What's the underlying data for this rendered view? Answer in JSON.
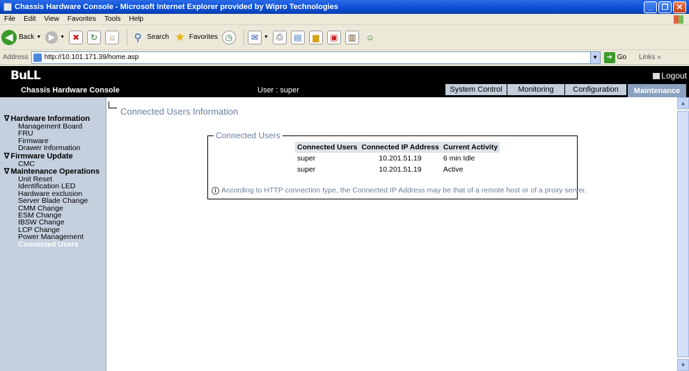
{
  "window": {
    "title": "Chassis Hardware Console - Microsoft Internet Explorer provided by Wipro Technologies"
  },
  "menu": [
    "File",
    "Edit",
    "View",
    "Favorites",
    "Tools",
    "Help"
  ],
  "toolbar": {
    "back": "Back",
    "search": "Search",
    "favorites": "Favorites"
  },
  "address": {
    "label": "Address",
    "url": "http://10.101.171.39/home.asp",
    "go": "Go",
    "links": "Links »"
  },
  "header": {
    "logo": "BuLL",
    "logout": "Logout",
    "console_name": "Chassis Hardware Console",
    "user": "User : super",
    "tabs": [
      "System Control",
      "Monitoring",
      "Configuration",
      "Maintenance"
    ],
    "active_tab": "Maintenance"
  },
  "sidebar": {
    "hardware_information": {
      "title": "Hardware Information",
      "items": [
        "Management Board",
        "FRU",
        "Firmware",
        "Drawer Information"
      ]
    },
    "firmware_update": {
      "title": "Firmware Update",
      "items": [
        "CMC"
      ]
    },
    "maintenance_operations": {
      "title": "Maintenance Operations",
      "items": [
        "Unit Reset",
        "Identification LED",
        "Hardware exclusion",
        "Server Blade Change",
        "CMM Change",
        "ESM Change",
        "IBSW Change",
        "LCP Change",
        "Power Management",
        "Connected Users"
      ]
    },
    "active_item": "Connected Users"
  },
  "main": {
    "title": "Connected Users Information",
    "box_title": "Connected Users",
    "columns": [
      "Connected Users",
      "Connected IP Address",
      "Current Activity"
    ],
    "rows": [
      [
        "super",
        "10.201.51.19",
        "6 min Idle"
      ],
      [
        "super",
        "10.201.51.19",
        "Active"
      ]
    ],
    "note": "According to HTTP connection type, the Connected IP Address may be that of a remote host or of a proxy server."
  },
  "colors": {
    "header_bg": "#000000",
    "sidebar_bg": "#c4d0de",
    "title_text": "#6a7f9b",
    "active_tab": "#8aa1c0"
  }
}
